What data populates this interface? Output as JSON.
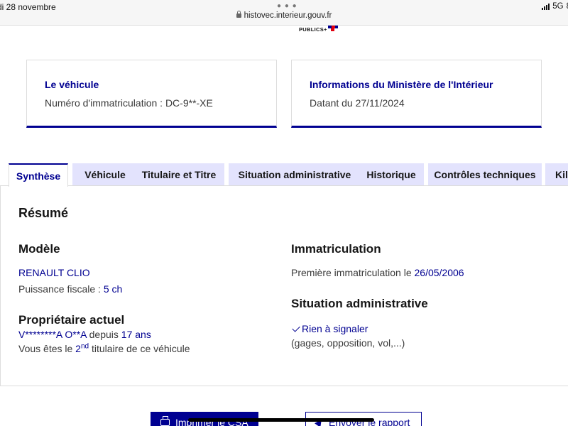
{
  "status_bar": {
    "date": "di 28 novembre",
    "url": "histovec.interieur.gouv.fr",
    "network": "5G",
    "battery": "8"
  },
  "logo": {
    "text": "PUBLICS+"
  },
  "cards": {
    "vehicle": {
      "title": "Le véhicule",
      "text": "Numéro d'immatriculation : DC-9**-XE"
    },
    "ministry": {
      "title": "Informations du Ministère de l'Intérieur",
      "text": "Datant du 27/11/2024"
    }
  },
  "tabs": [
    {
      "label": "Synthèse",
      "active": true
    },
    {
      "label": "Véhicule",
      "active": false
    },
    {
      "label": "Titulaire et Titre",
      "active": false
    },
    {
      "label": "Situation administrative",
      "active": false
    },
    {
      "label": "Historique",
      "active": false
    },
    {
      "label": "Contrôles techniques",
      "active": false
    },
    {
      "label": "Kilo",
      "active": false
    }
  ],
  "summary": {
    "heading": "Résumé",
    "modele": {
      "heading": "Modèle",
      "name": "RENAULT CLIO",
      "puissance_label": "Puissance fiscale : ",
      "puissance_value": "5 ch"
    },
    "proprietaire": {
      "heading": "Propriétaire actuel",
      "name": "V********A O**A",
      "depuis_label": " depuis ",
      "depuis_value": "17 ans",
      "rank_prefix": "Vous êtes le ",
      "rank_number": "2",
      "rank_sup": "nd",
      "rank_suffix": " titulaire de ce véhicule"
    },
    "immatriculation": {
      "heading": "Immatriculation",
      "label": "Première immatriculation le ",
      "date": "26/05/2006"
    },
    "situation": {
      "heading": "Situation administrative",
      "status": "Rien à signaler",
      "details": "(gages, opposition, vol,...)"
    }
  },
  "buttons": {
    "print": "Imprimer le CSA",
    "send": "Envoyer le rapport"
  },
  "colors": {
    "primary": "#000091",
    "tab_background": "#e3e3fd",
    "text": "#3a3a3a"
  }
}
